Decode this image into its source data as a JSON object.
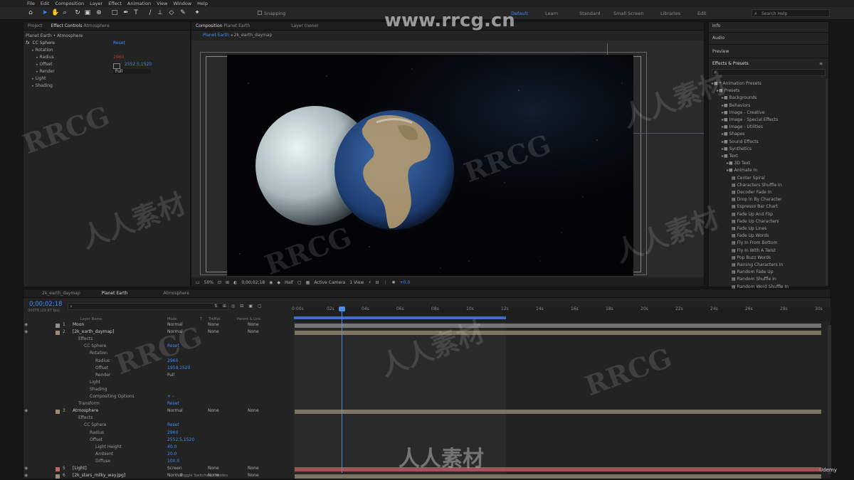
{
  "menu": [
    "File",
    "Edit",
    "Composition",
    "Layer",
    "Effect",
    "Animation",
    "View",
    "Window",
    "Help"
  ],
  "toolbar": {
    "snapping": "Snapping",
    "workspaces": [
      "Default",
      "Learn",
      "Standard",
      "Small Screen",
      "Libraries",
      "Edit"
    ],
    "search": "Search Help"
  },
  "watermark": {
    "url": "www.rrcg.cn",
    "text_cn": "人人素材",
    "text_en": "RRCG"
  },
  "effect_controls": {
    "tabs": [
      "Project",
      "Effect Controls",
      "Atmosphere"
    ],
    "layer_path": "Planet Earth • Atmosphere",
    "effect_name": "CC Sphere",
    "reset": "Reset",
    "rows": [
      {
        "label": "Rotation",
        "value": ""
      },
      {
        "label": "Radius",
        "value": "2960"
      },
      {
        "label": "Offset",
        "value": "2552.5,1520"
      },
      {
        "label": "Render",
        "value": "Full"
      },
      {
        "label": "Light",
        "value": ""
      },
      {
        "label": "Shading",
        "value": ""
      }
    ]
  },
  "composition": {
    "tab_label": "Composition",
    "comp_name": "Planet Earth",
    "layer_tab": "Layer (none)",
    "breadcrumbs": [
      "Planet Earth",
      "2k_earth_daymap"
    ],
    "zoom": "50%",
    "timecode": "0;00;02;18",
    "resolution": "Half",
    "camera": "Active Camera",
    "views": "1 View",
    "exposure": "+0.0"
  },
  "right_panel": {
    "sections": [
      "Info",
      "Audio",
      "Preview",
      "Effects & Presets"
    ],
    "tree": [
      {
        "label": "* Animation Presets",
        "level": 0,
        "type": "folder"
      },
      {
        "label": "Presets",
        "level": 1,
        "type": "folder"
      },
      {
        "label": "Backgrounds",
        "level": 2,
        "type": "folder"
      },
      {
        "label": "Behaviors",
        "level": 2,
        "type": "folder"
      },
      {
        "label": "Image - Creative",
        "level": 2,
        "type": "folder"
      },
      {
        "label": "Image - Special Effects",
        "level": 2,
        "type": "folder"
      },
      {
        "label": "Image - Utilities",
        "level": 2,
        "type": "folder"
      },
      {
        "label": "Shapes",
        "level": 2,
        "type": "folder"
      },
      {
        "label": "Sound Effects",
        "level": 2,
        "type": "folder"
      },
      {
        "label": "Synthetics",
        "level": 2,
        "type": "folder"
      },
      {
        "label": "Text",
        "level": 2,
        "type": "folder"
      },
      {
        "label": "3D Text",
        "level": 3,
        "type": "folder"
      },
      {
        "label": "Animate In",
        "level": 3,
        "type": "folder"
      },
      {
        "label": "Center Spiral",
        "level": 4,
        "type": "preset"
      },
      {
        "label": "Characters Shuffle In",
        "level": 4,
        "type": "preset"
      },
      {
        "label": "Decoder Fade In",
        "level": 4,
        "type": "preset"
      },
      {
        "label": "Drop In By Character",
        "level": 4,
        "type": "preset"
      },
      {
        "label": "Espresso Bar Chart",
        "level": 4,
        "type": "preset"
      },
      {
        "label": "Fade Up And Flip",
        "level": 4,
        "type": "preset"
      },
      {
        "label": "Fade Up Characters",
        "level": 4,
        "type": "preset"
      },
      {
        "label": "Fade Up Lines",
        "level": 4,
        "type": "preset"
      },
      {
        "label": "Fade Up Words",
        "level": 4,
        "type": "preset"
      },
      {
        "label": "Fly In From Bottom",
        "level": 4,
        "type": "preset"
      },
      {
        "label": "Fly In With A Twist",
        "level": 4,
        "type": "preset"
      },
      {
        "label": "Pop Buzz Words",
        "level": 4,
        "type": "preset"
      },
      {
        "label": "Raining Characters In",
        "level": 4,
        "type": "preset"
      },
      {
        "label": "Random Fade Up",
        "level": 4,
        "type": "preset"
      },
      {
        "label": "Random Shuffle In",
        "level": 4,
        "type": "preset"
      },
      {
        "label": "Random Word Shuffle In",
        "level": 4,
        "type": "preset"
      }
    ]
  },
  "timeline": {
    "tabs": [
      "2k_earth_daymap",
      "Planet Earth",
      "Atmosphere"
    ],
    "timecode": "0;00;02;18",
    "timecode_sub": "00078 (29.97 fps)",
    "columns": [
      "Layer Name",
      "Mode",
      "T",
      "TrkMat",
      "Parent & Link"
    ],
    "ruler": [
      "0:00s",
      "02s",
      "04s",
      "06s",
      "08s",
      "10s",
      "12s",
      "14s",
      "16s",
      "18s",
      "20s",
      "22s",
      "24s",
      "26s",
      "28s",
      "30s"
    ],
    "rows": [
      {
        "indent": 0,
        "num": "1",
        "name": "Moon",
        "mode": "Normal",
        "trk": "None",
        "parent": "None",
        "color": "#8f8f8f"
      },
      {
        "indent": 0,
        "num": "2",
        "name": "[2k_earth_daymap]",
        "mode": "Normal",
        "trk": "None",
        "parent": "None",
        "color": "#9a8d77"
      },
      {
        "indent": 1,
        "num": "",
        "name": "Effects",
        "mode": "",
        "trk": "",
        "parent": "",
        "color": ""
      },
      {
        "indent": 2,
        "num": "",
        "name": "CC Sphere",
        "mode": "Reset",
        "trk": "",
        "parent": "",
        "color": ""
      },
      {
        "indent": 3,
        "num": "",
        "name": "Rotation",
        "mode": "",
        "trk": "",
        "parent": "",
        "color": ""
      },
      {
        "indent": 4,
        "num": "",
        "name": "Radius",
        "mode": "2960",
        "trk": "",
        "parent": "",
        "color": ""
      },
      {
        "indent": 4,
        "num": "",
        "name": "Offset",
        "mode": "1959,1520",
        "trk": "",
        "parent": "",
        "color": ""
      },
      {
        "indent": 4,
        "num": "",
        "name": "Render",
        "mode": "Full",
        "trk": "",
        "parent": "",
        "color": ""
      },
      {
        "indent": 3,
        "num": "",
        "name": "Light",
        "mode": "",
        "trk": "",
        "parent": "",
        "color": ""
      },
      {
        "indent": 3,
        "num": "",
        "name": "Shading",
        "mode": "",
        "trk": "",
        "parent": "",
        "color": ""
      },
      {
        "indent": 3,
        "num": "",
        "name": "Compositing Options",
        "mode": "+ –",
        "trk": "",
        "parent": "",
        "color": ""
      },
      {
        "indent": 1,
        "num": "",
        "name": "Transform",
        "mode": "Reset",
        "trk": "",
        "parent": "",
        "color": ""
      },
      {
        "indent": 0,
        "num": "3",
        "name": "Atmosphere",
        "mode": "Normal",
        "trk": "None",
        "parent": "None",
        "color": "#9a8d77"
      },
      {
        "indent": 1,
        "num": "",
        "name": "Effects",
        "mode": "",
        "trk": "",
        "parent": "",
        "color": ""
      },
      {
        "indent": 2,
        "num": "",
        "name": "CC Sphere",
        "mode": "Reset",
        "trk": "",
        "parent": "",
        "color": ""
      },
      {
        "indent": 3,
        "num": "",
        "name": "Radius",
        "mode": "2960",
        "trk": "",
        "parent": "",
        "color": ""
      },
      {
        "indent": 3,
        "num": "",
        "name": "Offset",
        "mode": "2552.5,1520",
        "trk": "",
        "parent": "",
        "color": ""
      },
      {
        "indent": 4,
        "num": "",
        "name": "Light Height",
        "mode": "40.0",
        "trk": "",
        "parent": "",
        "color": ""
      },
      {
        "indent": 4,
        "num": "",
        "name": "Ambient",
        "mode": "20.0",
        "trk": "",
        "parent": "",
        "color": ""
      },
      {
        "indent": 4,
        "num": "",
        "name": "Diffuse",
        "mode": "100.0",
        "trk": "",
        "parent": "",
        "color": ""
      },
      {
        "indent": 0,
        "num": "5",
        "name": "[Light]",
        "mode": "Screen",
        "trk": "None",
        "parent": "None",
        "color": "#c86464"
      },
      {
        "indent": 0,
        "num": "6",
        "name": "[2k_stars_milky_way.jpg]",
        "mode": "Normal",
        "trk": "None",
        "parent": "None",
        "color": "#9a8d77"
      }
    ],
    "footer": "Toggle Switches / Modes",
    "brand": "Udemy"
  }
}
